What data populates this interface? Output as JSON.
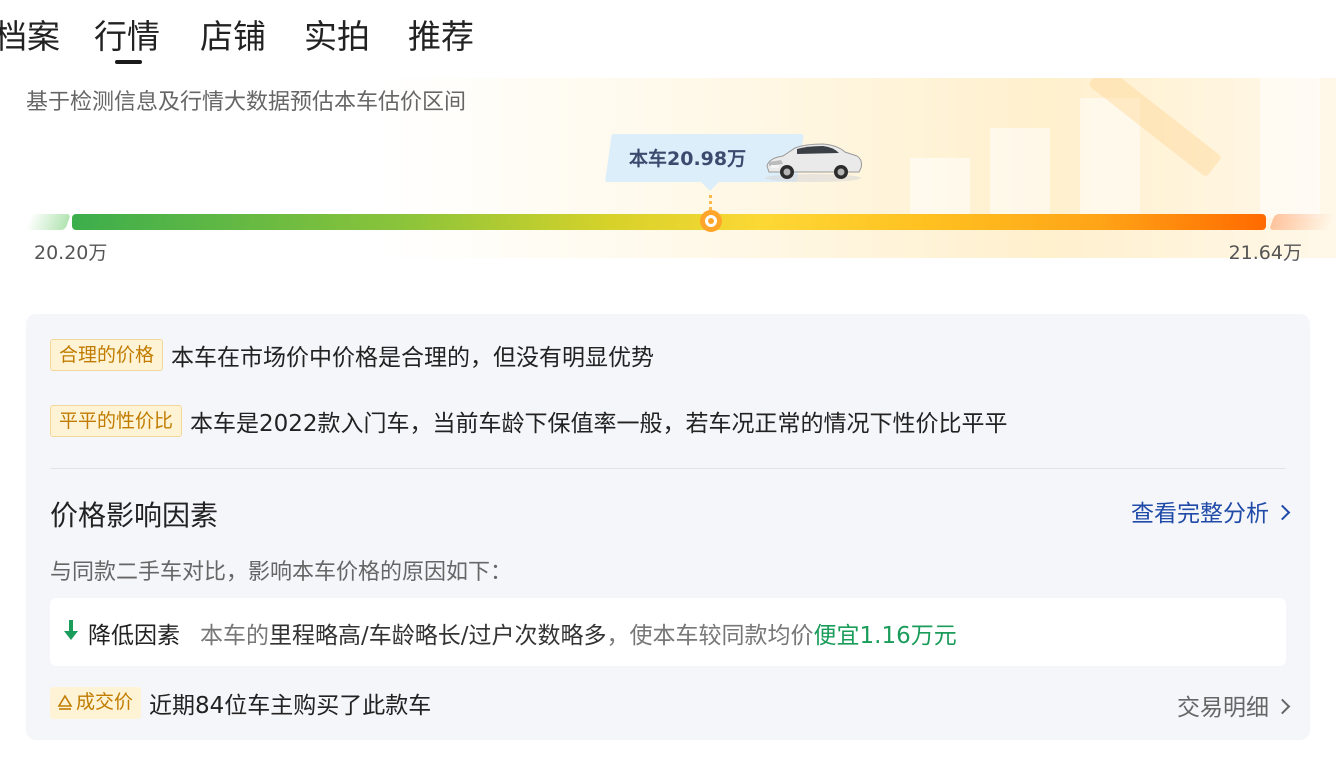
{
  "tabs": [
    {
      "label": "档案"
    },
    {
      "label": "行情",
      "active": true
    },
    {
      "label": "店铺"
    },
    {
      "label": "实拍"
    },
    {
      "label": "推荐"
    }
  ],
  "price_band": {
    "description": "基于检测信息及行情大数据预估本车估价区间",
    "current_label": "本车20.98万",
    "min_label": "20.20万",
    "max_label": "21.64万",
    "min_value": 20.2,
    "max_value": 21.64,
    "current_value": 20.98
  },
  "assessments": [
    {
      "tag": "合理的价格",
      "text": "本车在市场价中价格是合理的，但没有明显优势"
    },
    {
      "tag": "平平的性价比",
      "text": "本车是2022款入门车，当前车龄下保值率一般，若车况正常的情况下性价比平平"
    }
  ],
  "factors_section": {
    "title": "价格影响因素",
    "link": "查看完整分析",
    "description": "与同款二手车对比，影响本车价格的原因如下：",
    "factor": {
      "label": "降低因素",
      "prefix": "本车的",
      "items": "里程略高/车龄略长/过户次数略多",
      "middle": "，使本车较同款均价",
      "result": "便宜1.16万元"
    }
  },
  "deal": {
    "tag": "成交价",
    "text": "近期84位车主购买了此款车",
    "link": "交易明细"
  },
  "colors": {
    "accent_blue": "#1f4aa8",
    "tag_text": "#c17c00",
    "tag_bg": "#fff3d6",
    "green": "#1a9c5a",
    "marker": "#ffa52a"
  }
}
